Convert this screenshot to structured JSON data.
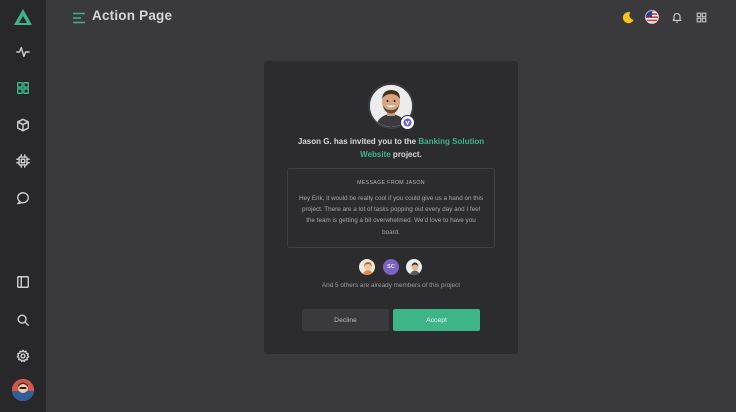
{
  "header": {
    "title": "Action Page",
    "icons": [
      "moon-icon",
      "us-flag-icon",
      "bell-icon",
      "grid-icon"
    ]
  },
  "sidebar": {
    "items": [
      {
        "name": "activity-icon"
      },
      {
        "name": "dashboard-icon",
        "active": true
      },
      {
        "name": "cube-icon"
      },
      {
        "name": "cpu-icon"
      },
      {
        "name": "chat-icon"
      }
    ],
    "bottom_items": [
      {
        "name": "panel-icon"
      },
      {
        "name": "search-icon"
      },
      {
        "name": "settings-icon"
      }
    ]
  },
  "card": {
    "invite_prefix": "Jason G. has invited you to the ",
    "project_name": "Banking Solution Website",
    "invite_suffix": " project.",
    "message_heading": "MESSAGE FROM JASON",
    "message_body": "Hey Erik, it would be really cool if you could give us a hand on this project. There are a lot of tasks popping out every day and I feel the team is getting a bit overwhelmed. We'd love to have you board.",
    "member_initials": "SC",
    "members_text": "And 5 others are already members of this project",
    "decline_label": "Decline",
    "accept_label": "Accept"
  },
  "colors": {
    "accent": "#3eb489",
    "background": "#3a3a3d",
    "sidebar": "#28282b",
    "card": "#2c2c2f",
    "initials_badge": "#7c63c2"
  }
}
